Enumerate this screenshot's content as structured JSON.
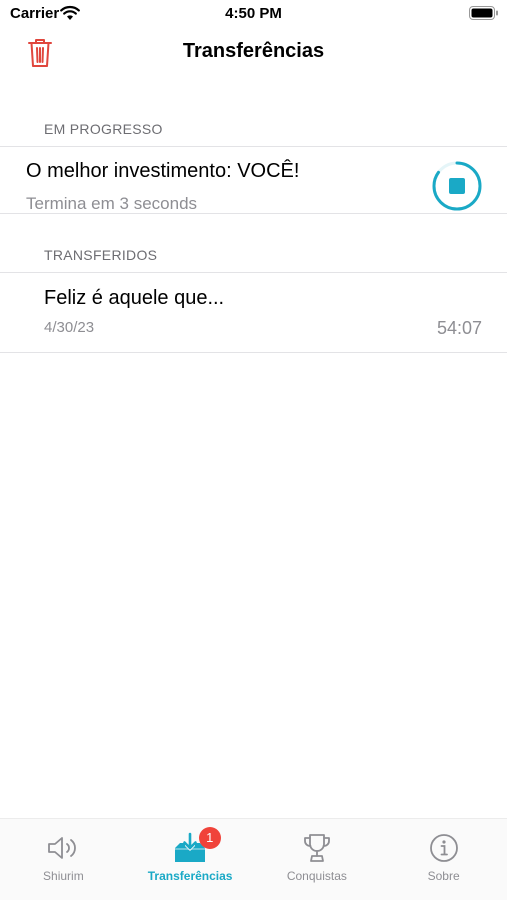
{
  "status_bar": {
    "carrier": "Carrier",
    "time": "4:50 PM"
  },
  "nav": {
    "title": "Transferências",
    "trash_icon": "trash-icon"
  },
  "sections": {
    "in_progress": {
      "header": "EM PROGRESSO",
      "item": {
        "title": "O melhor investimento: VOCÊ!",
        "subtitle": "Termina em 3 seconds",
        "progress": 0.85
      }
    },
    "downloaded": {
      "header": "TRANSFERIDOS",
      "item": {
        "title": "Feliz é aquele que...",
        "date": "4/30/23",
        "duration": "54:07"
      }
    }
  },
  "tabs": [
    {
      "label": "Shiurim",
      "icon": "speaker-icon"
    },
    {
      "label": "Transferências",
      "icon": "download-tray-icon",
      "badge": "1"
    },
    {
      "label": "Conquistas",
      "icon": "trophy-icon"
    },
    {
      "label": "Sobre",
      "icon": "info-icon"
    }
  ],
  "colors": {
    "accent": "#1aa9c6",
    "destructive": "#e0463d",
    "badge": "#f0433a",
    "secondary_text": "#8e8e93"
  }
}
